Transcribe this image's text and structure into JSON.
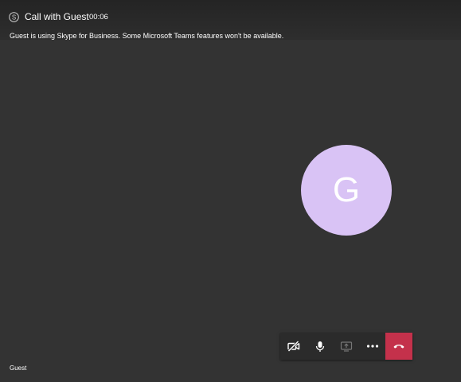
{
  "header": {
    "title": "Call with Guest",
    "timer": "00:06",
    "icon": "skype-icon"
  },
  "notice": "Guest is using Skype for Business. Some Microsoft Teams features won't be available.",
  "avatar": {
    "initial": "G",
    "color": "#d9c3f5"
  },
  "controls": [
    {
      "name": "video-off-icon",
      "state": "off"
    },
    {
      "name": "microphone-icon",
      "state": "on"
    },
    {
      "name": "share-screen-icon",
      "state": "disabled"
    },
    {
      "name": "more-options-icon",
      "state": "enabled"
    },
    {
      "name": "hang-up-icon",
      "color": "#c4314b"
    }
  ],
  "participant": {
    "name": "Guest"
  }
}
